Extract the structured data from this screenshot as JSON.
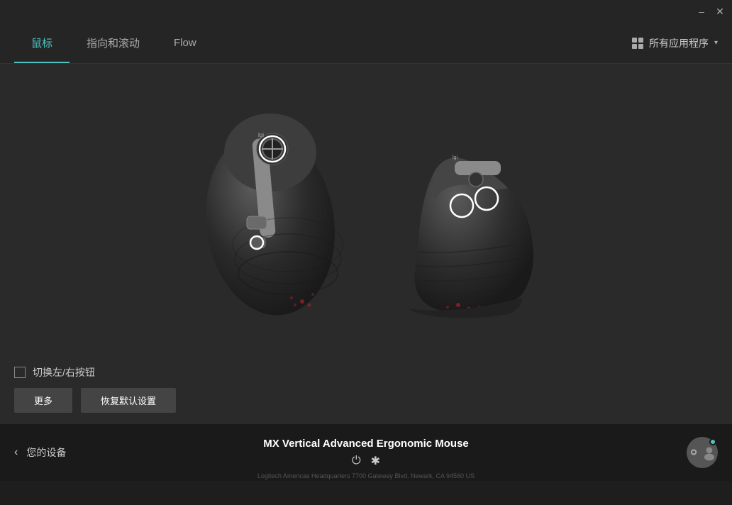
{
  "titlebar": {
    "minimize_label": "–",
    "close_label": "✕"
  },
  "tabs": {
    "tab1_label": "鼠标",
    "tab2_label": "指向和滚动",
    "tab3_label": "Flow",
    "app_selector_label": "所有应用程序"
  },
  "controls": {
    "checkbox_label": "切换左/右按钮",
    "btn_more_label": "更多",
    "btn_reset_label": "恢复默认设置"
  },
  "footer": {
    "back_label": "您的设备",
    "device_name": "MX Vertical Advanced Ergonomic Mouse"
  },
  "watermark": {
    "text": "Logitech Americas Headquarters 7700 Gateway Blvd. Newark, CA 94560 US"
  }
}
